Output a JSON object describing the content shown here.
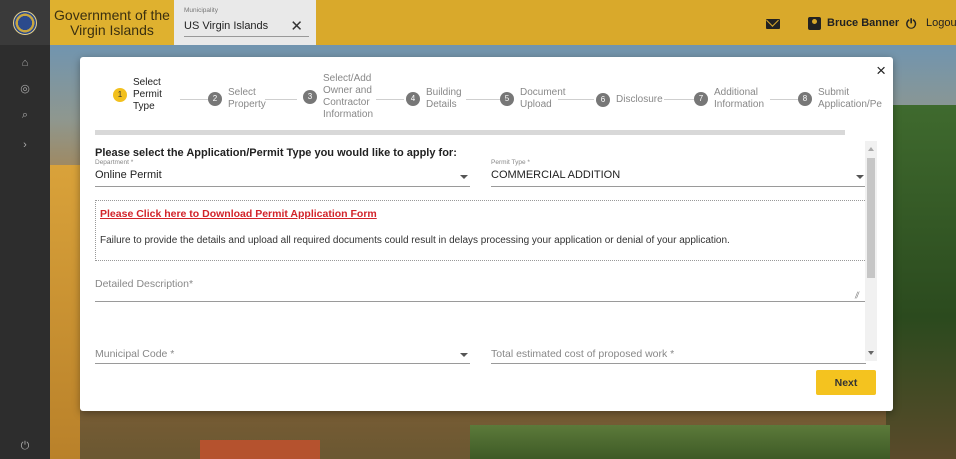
{
  "header": {
    "gov_line1": "Government of the",
    "gov_line2": "Virgin Islands",
    "municipality_label": "Municipality",
    "municipality_value": "US Virgin Islands",
    "clear_symbol": "✕",
    "user_name": "Bruce Banner",
    "logout_label": "Logout",
    "icons": [
      "seal-logo",
      "mail-icon",
      "user-icon",
      "power-icon"
    ],
    "accent_color": "#d9a92b"
  },
  "siderail": {
    "icons": [
      "home-icon",
      "settings-icon",
      "search-icon",
      "chevron-right-icon",
      "power-icon"
    ]
  },
  "wizard": {
    "close_symbol": "×",
    "steps": [
      {
        "num": "1",
        "line1": "Select",
        "line2": "Permit",
        "line3": "Type",
        "line4": ""
      },
      {
        "num": "2",
        "line1": "Select",
        "line2": "Property",
        "line3": "",
        "line4": ""
      },
      {
        "num": "3",
        "line1": "Select/Add",
        "line2": "Owner and",
        "line3": "Contractor",
        "line4": "Information"
      },
      {
        "num": "4",
        "line1": "Building",
        "line2": "Details",
        "line3": "",
        "line4": ""
      },
      {
        "num": "5",
        "line1": "Document",
        "line2": "Upload",
        "line3": "",
        "line4": ""
      },
      {
        "num": "6",
        "line1": "Disclosure",
        "line2": "",
        "line3": "",
        "line4": ""
      },
      {
        "num": "7",
        "line1": "Additional",
        "line2": "Information",
        "line3": "",
        "line4": ""
      },
      {
        "num": "8",
        "line1": "Submit",
        "line2": "Application/Pe",
        "line3": "",
        "line4": ""
      }
    ],
    "active_step": 1,
    "heading": "Please select the Application/Permit Type you would like to apply for:",
    "department": {
      "label": "Department *",
      "value": "Online Permit"
    },
    "permit_type": {
      "label": "Permit Type *",
      "value": "COMMERCIAL ADDITION"
    },
    "download_link": "Please Click here to Download Permit Application Form",
    "warning": "Failure to provide the details and upload all required documents could result in delays processing your application or denial of your application.",
    "description_placeholder": "Detailed Description*",
    "municipal_code_placeholder": "Municipal Code *",
    "estimated_cost_placeholder": "Total estimated cost of proposed work *",
    "next_label": "Next",
    "link_color": "#d2232a",
    "button_color": "#f4c31f"
  }
}
